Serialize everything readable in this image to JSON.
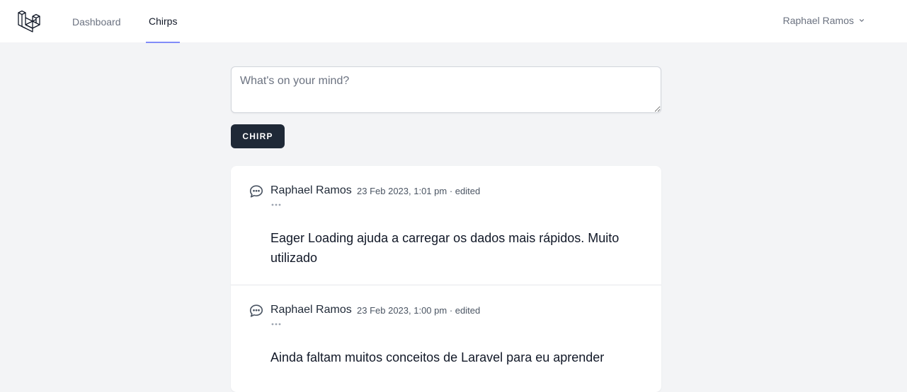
{
  "nav": {
    "links": [
      {
        "label": "Dashboard",
        "active": false
      },
      {
        "label": "Chirps",
        "active": true
      }
    ],
    "user_name": "Raphael Ramos"
  },
  "composer": {
    "placeholder": "What's on your mind?",
    "value": "",
    "submit_label": "CHIRP"
  },
  "chirps": [
    {
      "author": "Raphael Ramos",
      "timestamp": "23 Feb 2023, 1:01 pm",
      "edited": "· edited",
      "message": "Eager Loading ajuda a carregar os dados mais rápidos. Muito utilizado"
    },
    {
      "author": "Raphael Ramos",
      "timestamp": "23 Feb 2023, 1:00 pm",
      "edited": "· edited",
      "message": "Ainda faltam muitos conceitos de Laravel para eu aprender"
    }
  ],
  "colors": {
    "accent": "#818cf8",
    "button": "#1f2937",
    "background": "#f3f4f6"
  },
  "icons": {
    "logo": "laravel-logo",
    "chirp": "chat-bubble-icon",
    "options": "ellipsis-icon",
    "dropdown": "chevron-down-icon"
  }
}
